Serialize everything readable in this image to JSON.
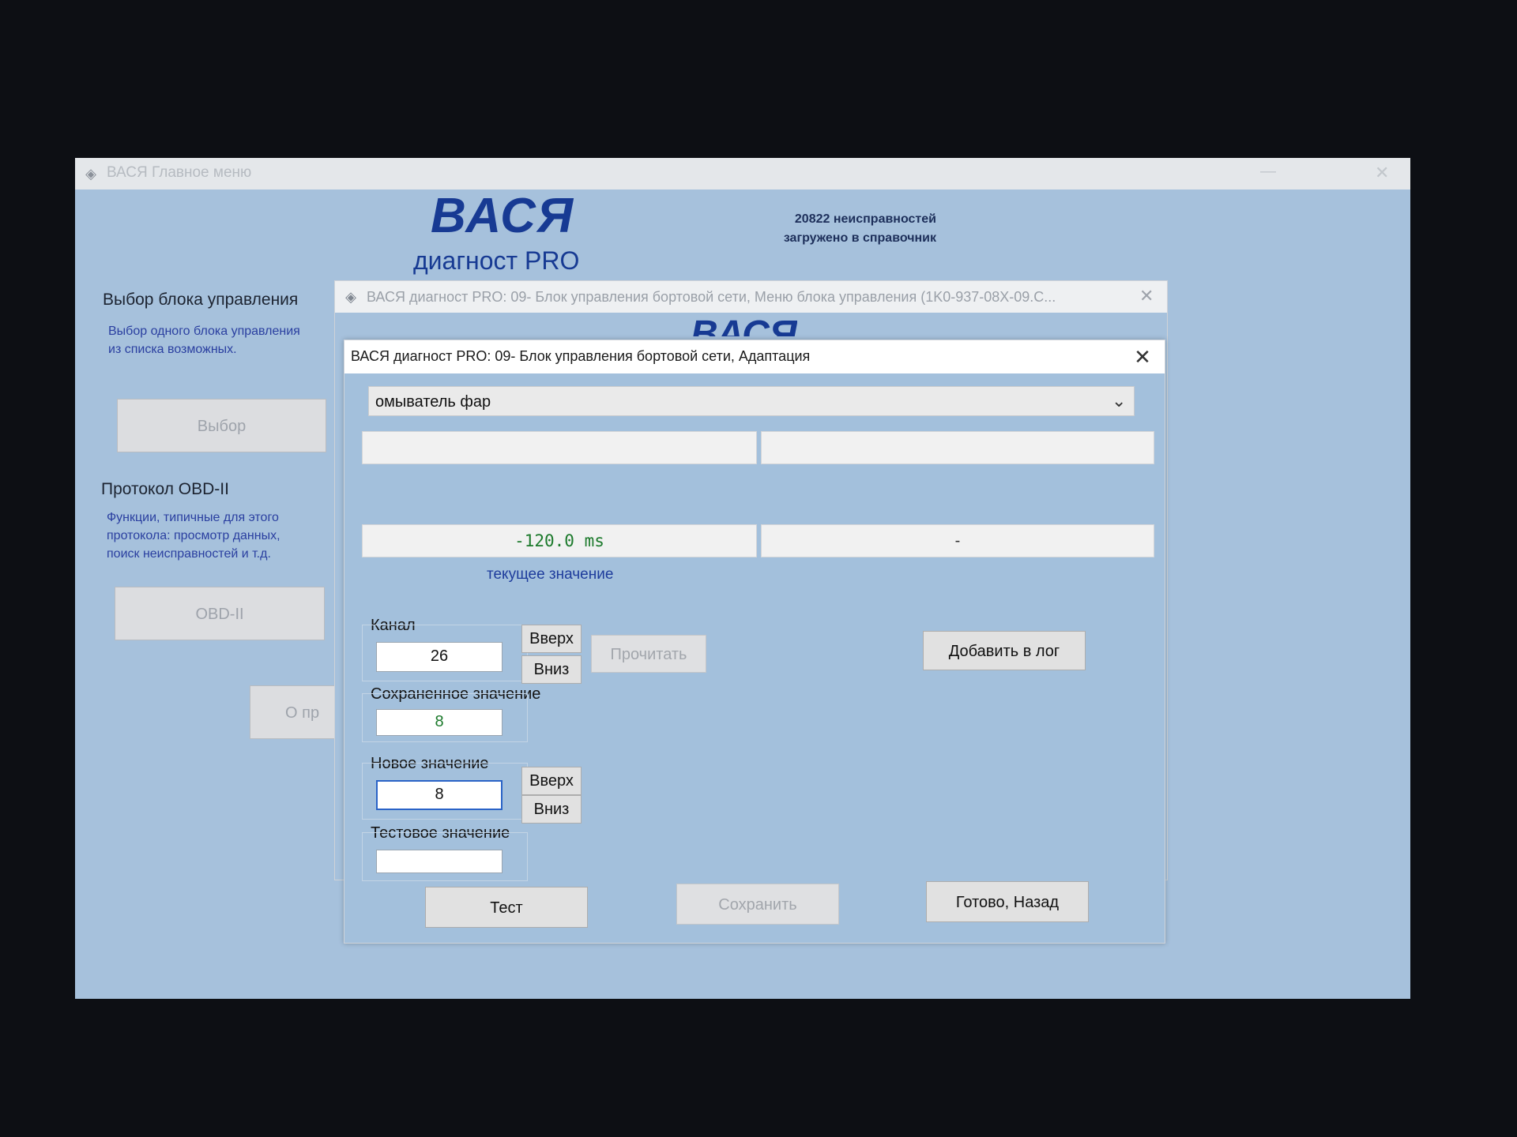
{
  "main_window": {
    "title": "ВАСЯ  Главное меню",
    "minimize": "—",
    "close": "✕",
    "logo": "ВАСЯ",
    "logo_sub": "диагност PRO",
    "faults_info": "20822 неисправностей\nзагружено в справочник",
    "select_section": {
      "title": "Выбор блока управления",
      "description": "Выбор одного блока управления\nиз списка возможных.",
      "button": "Выбор"
    },
    "obd_section": {
      "title": "Протокол OBD-II",
      "description": "Функции, типичные для этого\nпротокола: просмотр данных,\nпоиск неисправностей и т.д.",
      "button": "OBD-II"
    },
    "about_button": "О пр"
  },
  "sub_window": {
    "title": "ВАСЯ диагност PRO: 09- Блок управления бортовой сети,  Меню блока управления (1K0-937-08X-09.C...",
    "logo": "ВАСЯ",
    "close": "✕"
  },
  "dialog": {
    "title": "ВАСЯ диагност PRO: 09- Блок управления бортовой сети, Адаптация",
    "close": "✕",
    "selected_function": "омыватель фар",
    "top_field_left": "",
    "top_field_right": "",
    "measured_value": "-120.0 ms",
    "measured_right": "-",
    "current_value_caption": "текущее значение",
    "channel_label": "Канал",
    "channel_value": "26",
    "up_label": "Вверх",
    "down_label": "Вниз",
    "read_button": "Прочитать",
    "add_log_button": "Добавить в лог",
    "saved_label": "Сохраненное значение",
    "saved_value": "8",
    "new_label": "Новое значение",
    "new_value": "8",
    "test_label": "Тестовое значение",
    "test_value": "",
    "test_button": "Тест",
    "save_button": "Сохранить",
    "done_button": "Готово, Назад"
  }
}
